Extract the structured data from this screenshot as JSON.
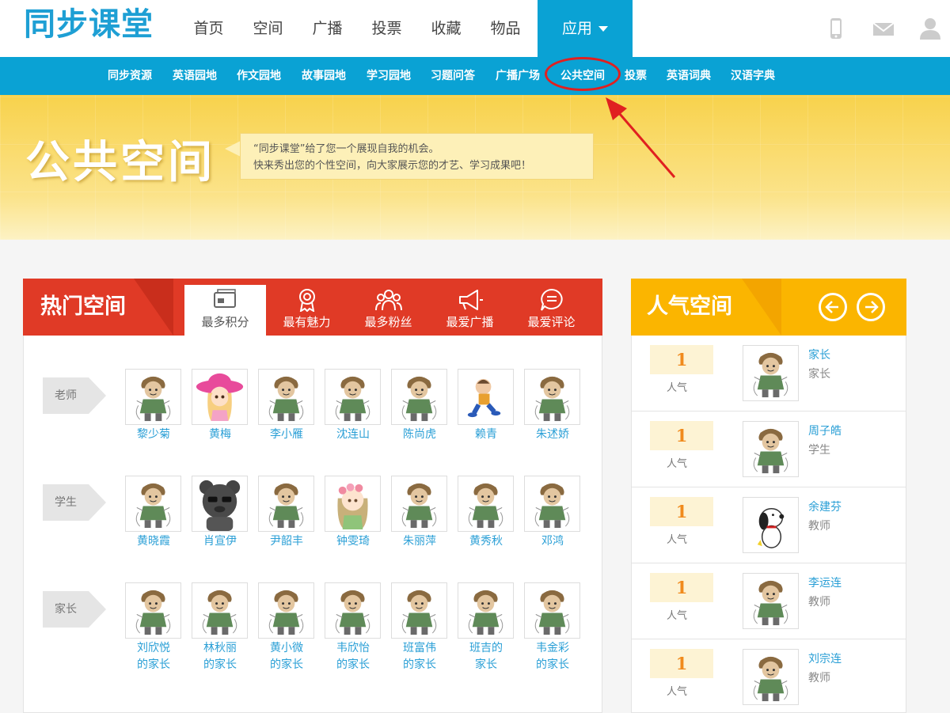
{
  "header": {
    "logo": "同步课堂",
    "nav": [
      "首页",
      "空间",
      "广播",
      "投票",
      "收藏",
      "物品"
    ],
    "app_menu": "应用",
    "icons": [
      "mobile-icon",
      "mail-icon",
      "user-icon"
    ]
  },
  "subnav": {
    "items": [
      "同步资源",
      "英语园地",
      "作文园地",
      "故事园地",
      "学习园地",
      "习题问答",
      "广播广场",
      "公共空间",
      "投票",
      "英语词典",
      "汉语字典"
    ],
    "highlighted": "公共空间"
  },
  "banner": {
    "title": "公共空间",
    "line1": "“同步课堂”给了您一个展现自我的机会。",
    "line2": "快来秀出您的个性空间，向大家展示您的才艺、学习成果吧！"
  },
  "hot": {
    "title": "热门空间",
    "tabs": [
      {
        "label": "最多积分",
        "icon": "card-icon",
        "active": true
      },
      {
        "label": "最有魅力",
        "icon": "ribbon-icon",
        "active": false
      },
      {
        "label": "最多粉丝",
        "icon": "people-icon",
        "active": false
      },
      {
        "label": "最爱广播",
        "icon": "megaphone-icon",
        "active": false
      },
      {
        "label": "最爱评论",
        "icon": "comment-icon",
        "active": false
      }
    ],
    "groups": [
      {
        "label": "老师",
        "members": [
          {
            "name": "黎少菊",
            "avatar": "cartoon-boy"
          },
          {
            "name": "黄梅",
            "avatar": "girl-pink-hat"
          },
          {
            "name": "李小雁",
            "avatar": "cartoon-boy"
          },
          {
            "name": "沈连山",
            "avatar": "cartoon-boy"
          },
          {
            "name": "陈尚虎",
            "avatar": "cartoon-boy"
          },
          {
            "name": "赖青",
            "avatar": "running-boy"
          },
          {
            "name": "朱述娇",
            "avatar": "cartoon-boy"
          }
        ]
      },
      {
        "label": "学生",
        "members": [
          {
            "name": "黄晓霞",
            "avatar": "cartoon-boy"
          },
          {
            "name": "肖宣伊",
            "avatar": "bear"
          },
          {
            "name": "尹韶丰",
            "avatar": "cartoon-boy"
          },
          {
            "name": "钟雯琦",
            "avatar": "girl-flowers"
          },
          {
            "name": "朱丽萍",
            "avatar": "cartoon-boy"
          },
          {
            "name": "黄秀秋",
            "avatar": "cartoon-boy"
          },
          {
            "name": "邓鸿",
            "avatar": "cartoon-boy"
          }
        ]
      },
      {
        "label": "家长",
        "members": [
          {
            "name": "刘欣悦",
            "name2": "的家长",
            "avatar": "cartoon-boy"
          },
          {
            "name": "林秋丽",
            "name2": "的家长",
            "avatar": "cartoon-boy"
          },
          {
            "name": "黄小微",
            "name2": "的家长",
            "avatar": "cartoon-boy"
          },
          {
            "name": "韦欣怡",
            "name2": "的家长",
            "avatar": "cartoon-boy"
          },
          {
            "name": "班富伟",
            "name2": "的家长",
            "avatar": "cartoon-boy"
          },
          {
            "name": "班吉的",
            "name2": "家长",
            "avatar": "cartoon-boy"
          },
          {
            "name": "韦金彩",
            "name2": "的家长",
            "avatar": "cartoon-boy"
          }
        ]
      }
    ]
  },
  "popular": {
    "title": "人气空间",
    "buttons": [
      "arrow-left-icon",
      "arrow-right-icon"
    ],
    "rank_label": "人气",
    "items": [
      {
        "count": "1",
        "name": "家长",
        "role": "家长",
        "avatar": "cartoon-boy"
      },
      {
        "count": "1",
        "name": "周子皓",
        "role": "学生",
        "avatar": "cartoon-boy"
      },
      {
        "count": "1",
        "name": "余建芬",
        "role": "教师",
        "avatar": "snoopy"
      },
      {
        "count": "1",
        "name": "李运连",
        "role": "教师",
        "avatar": "cartoon-boy"
      },
      {
        "count": "1",
        "name": "刘宗连",
        "role": "教师",
        "avatar": "cartoon-boy"
      }
    ]
  },
  "colors": {
    "brand_blue": "#0aa2d4",
    "hot_red": "#e03a26",
    "popular_orange": "#fbb500",
    "link_blue": "#2a9fd6",
    "annotation_red": "#e02020"
  }
}
